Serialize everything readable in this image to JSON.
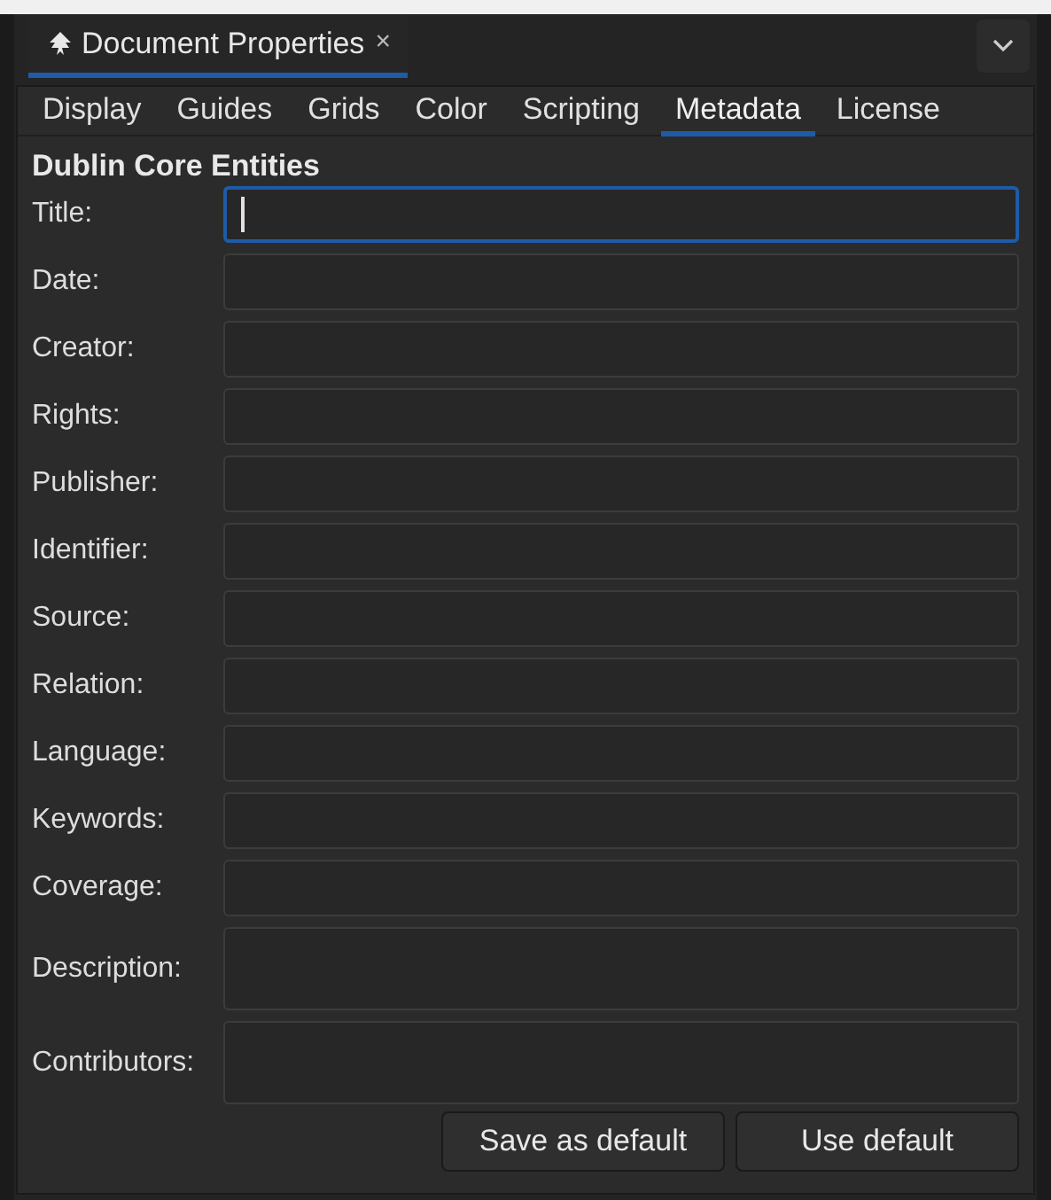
{
  "panel_tab": {
    "title": "Document Properties",
    "close": "×"
  },
  "tabs": [
    {
      "label": "Display",
      "selected": false
    },
    {
      "label": "Guides",
      "selected": false
    },
    {
      "label": "Grids",
      "selected": false
    },
    {
      "label": "Color",
      "selected": false
    },
    {
      "label": "Scripting",
      "selected": false
    },
    {
      "label": "Metadata",
      "selected": true
    },
    {
      "label": "License",
      "selected": false
    }
  ],
  "section_title": "Dublin Core Entities",
  "fields": [
    {
      "label": "Title:",
      "focused": true,
      "kind": "line"
    },
    {
      "label": "Date:",
      "focused": false,
      "kind": "line"
    },
    {
      "label": "Creator:",
      "focused": false,
      "kind": "line"
    },
    {
      "label": "Rights:",
      "focused": false,
      "kind": "line"
    },
    {
      "label": "Publisher:",
      "focused": false,
      "kind": "line"
    },
    {
      "label": "Identifier:",
      "focused": false,
      "kind": "line"
    },
    {
      "label": "Source:",
      "focused": false,
      "kind": "line"
    },
    {
      "label": "Relation:",
      "focused": false,
      "kind": "line"
    },
    {
      "label": "Language:",
      "focused": false,
      "kind": "line"
    },
    {
      "label": "Keywords:",
      "focused": false,
      "kind": "line"
    },
    {
      "label": "Coverage:",
      "focused": false,
      "kind": "line"
    },
    {
      "label": "Description:",
      "focused": false,
      "kind": "area"
    },
    {
      "label": "Contributors:",
      "focused": false,
      "kind": "area"
    }
  ],
  "buttons": [
    "Save as default",
    "Use default"
  ]
}
